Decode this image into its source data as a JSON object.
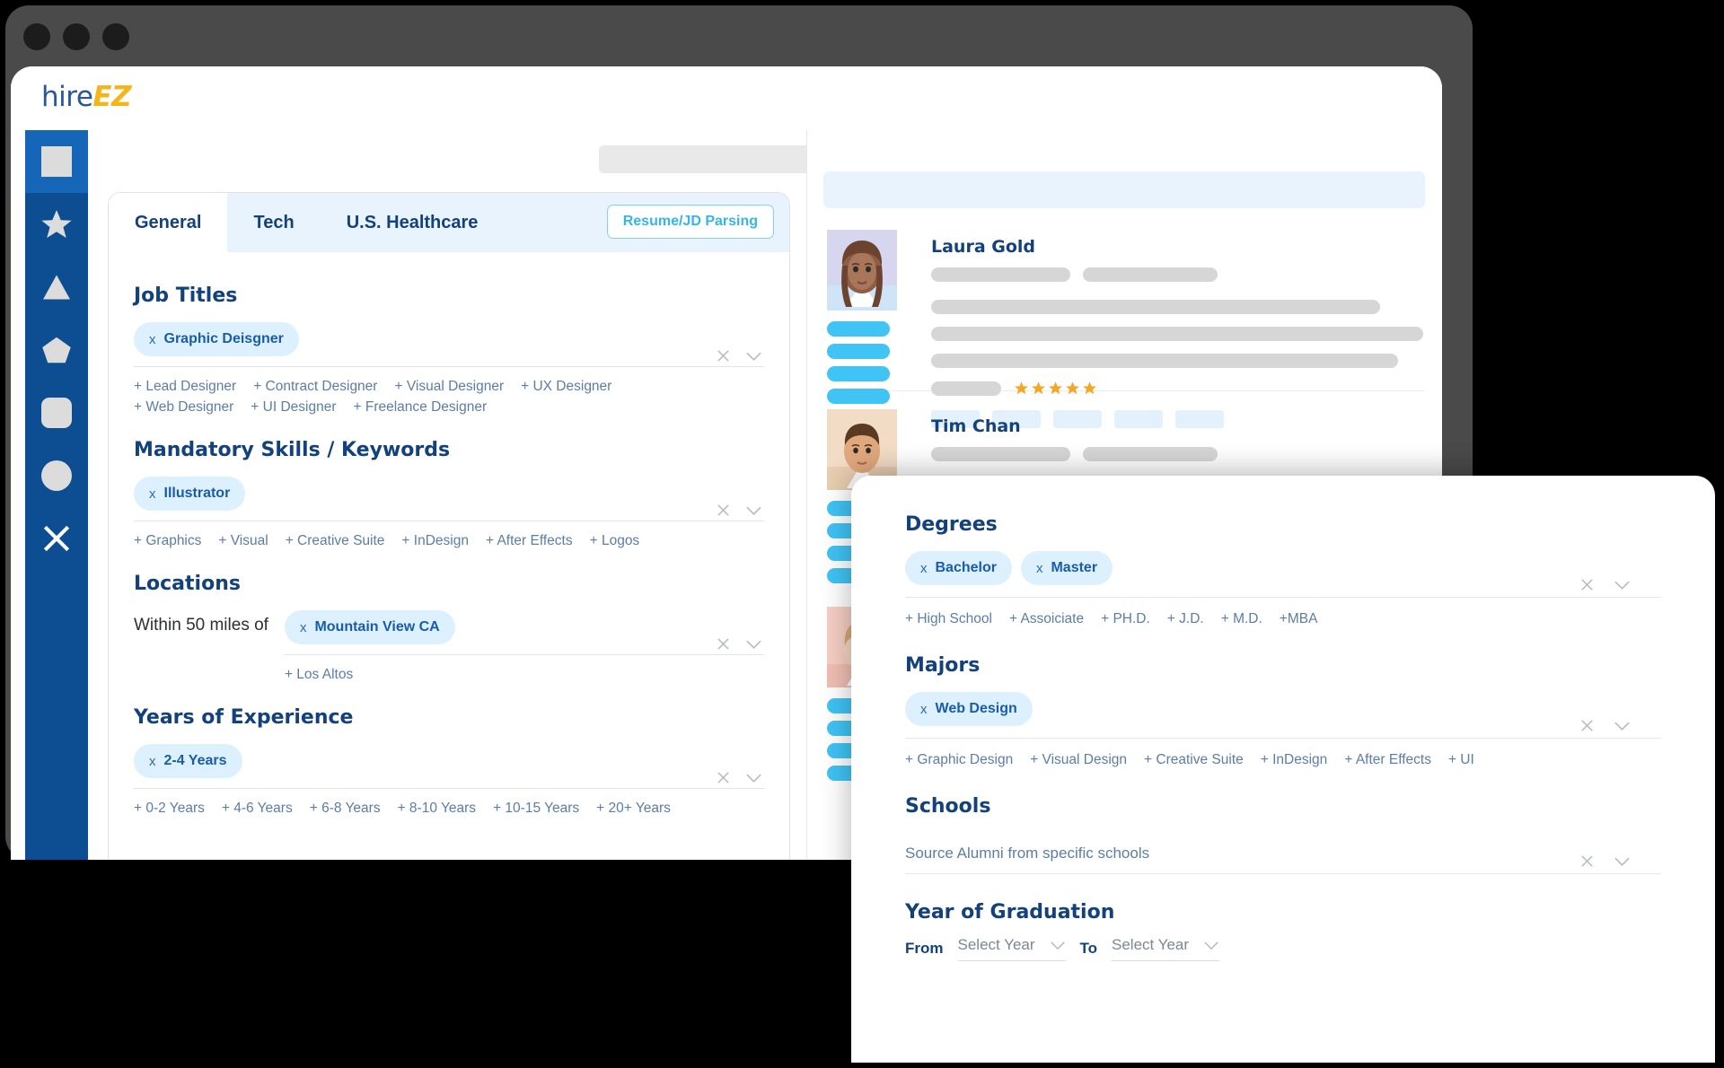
{
  "window": {
    "traffic_lights": 3
  },
  "header": {
    "logo_primary": "hire",
    "logo_accent": "EZ",
    "icons": [
      "square-icon",
      "star-icon",
      "triangle-icon",
      "pentagon-icon"
    ]
  },
  "sidebar": {
    "items": [
      {
        "icon": "square-icon",
        "active": true
      },
      {
        "icon": "star-icon",
        "active": false
      },
      {
        "icon": "triangle-icon",
        "active": false
      },
      {
        "icon": "pentagon-icon",
        "active": false
      },
      {
        "icon": "rounded-square-icon",
        "active": false
      },
      {
        "icon": "circle-icon",
        "active": false
      },
      {
        "icon": "close-x-icon",
        "active": false
      }
    ]
  },
  "filter_panel": {
    "tabs": [
      {
        "label": "General",
        "active": true
      },
      {
        "label": "Tech",
        "active": false
      },
      {
        "label": "U.S. Healthcare",
        "active": false
      }
    ],
    "parse_button": "Resume/JD Parsing",
    "sections": {
      "job_titles": {
        "title": "Job Titles",
        "chips": [
          "Graphic Deisgner"
        ],
        "suggestions": [
          "+ Lead Designer",
          "+ Contract Designer",
          "+ Visual Designer",
          "+ UX Designer",
          "+ Web Designer",
          "+ UI Designer",
          "+ Freelance Designer"
        ]
      },
      "skills": {
        "title": "Mandatory Skills / Keywords",
        "chips": [
          "Illustrator"
        ],
        "suggestions": [
          "+ Graphics",
          "+ Visual",
          "+ Creative Suite",
          "+ InDesign",
          "+ After Effects",
          "+ Logos"
        ]
      },
      "locations": {
        "title": "Locations",
        "radius_label": "Within 50 miles of",
        "chips": [
          "Mountain View CA"
        ],
        "suggestions": [
          "+ Los Altos"
        ]
      },
      "experience": {
        "title": "Years of Experience",
        "chips": [
          "2-4 Years"
        ],
        "suggestions": [
          "+ 0-2 Years",
          "+ 4-6 Years",
          "+ 6-8 Years",
          "+ 8-10 Years",
          "+ 10-15 Years",
          "+ 20+ Years"
        ]
      }
    }
  },
  "results": {
    "candidates": [
      {
        "name": "Laura Gold",
        "rating": 5,
        "avatar": "woman-brown-hair-avatar"
      },
      {
        "name": "Tim Chan",
        "rating": 0,
        "avatar": "man-short-hair-avatar"
      },
      {
        "name": "",
        "rating": 0,
        "avatar": "woman-light-hair-avatar"
      }
    ]
  },
  "education_panel": {
    "degrees": {
      "title": "Degrees",
      "chips": [
        "Bachelor",
        "Master"
      ],
      "suggestions": [
        "+ High School",
        "+ Assoiciate",
        "+ PH.D.",
        "+ J.D.",
        "+ M.D.",
        "+MBA"
      ]
    },
    "majors": {
      "title": "Majors",
      "chips": [
        "Web Design"
      ],
      "suggestions": [
        "+ Graphic Design",
        "+ Visual Design",
        "+ Creative Suite",
        "+ InDesign",
        "+ After Effects",
        "+ UI"
      ]
    },
    "schools": {
      "title": "Schools",
      "placeholder": "Source Alumni from specific schools"
    },
    "graduation": {
      "title": "Year of Graduation",
      "from_label": "From",
      "to_label": "To",
      "from_value": "Select Year",
      "to_value": "Select Year"
    }
  },
  "colors": {
    "brand_blue": "#13417c",
    "rail_blue": "#0d4d92",
    "accent_yellow": "#f5b518",
    "chip_bg": "#dcf0fd",
    "cyan": "#40c4f5"
  }
}
